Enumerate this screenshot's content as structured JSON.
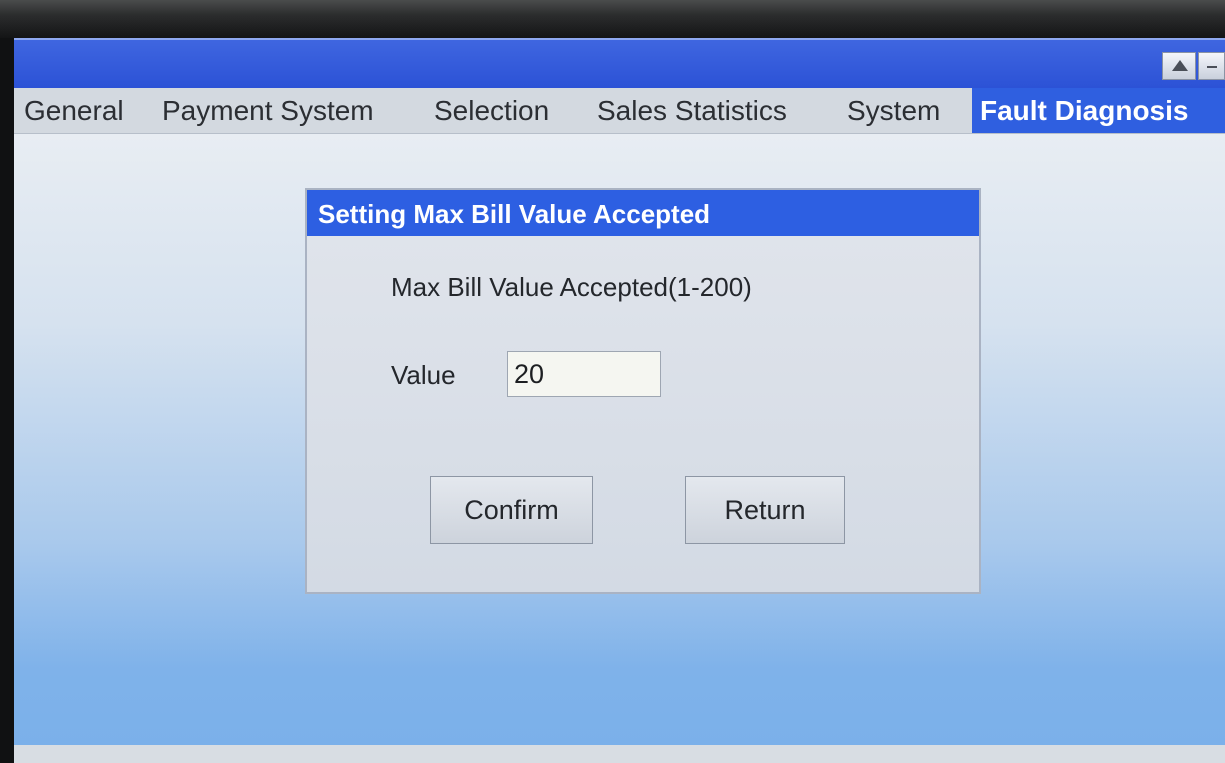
{
  "window": {
    "scroll_up_icon": "triangle-up-icon",
    "minimize_icon": "minimize-icon"
  },
  "tabs": [
    {
      "label": "General",
      "active": false
    },
    {
      "label": "Payment System",
      "active": false
    },
    {
      "label": "Selection",
      "active": false
    },
    {
      "label": "Sales Statistics",
      "active": false
    },
    {
      "label": "System",
      "active": false
    },
    {
      "label": "Fault Diagnosis",
      "active": true
    }
  ],
  "dialog": {
    "title": "Setting Max Bill Value Accepted",
    "heading": "Max Bill Value Accepted(1-200)",
    "value_label": "Value",
    "value": "20",
    "confirm_label": "Confirm",
    "return_label": "Return"
  },
  "colors": {
    "accent": "#2f5fe0",
    "titlebar": "#2c52d6"
  }
}
